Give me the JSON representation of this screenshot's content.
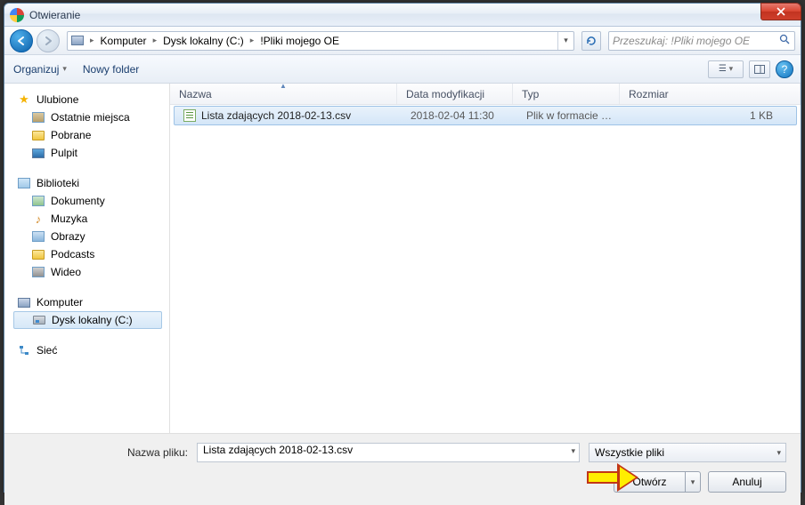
{
  "window": {
    "title": "Otwieranie"
  },
  "breadcrumb": {
    "parts": [
      "Komputer",
      "Dysk lokalny (C:)",
      "!Pliki mojego OE"
    ]
  },
  "search": {
    "placeholder": "Przeszukaj: !Pliki mojego OE"
  },
  "toolbar": {
    "organize": "Organizuj",
    "newfolder": "Nowy folder"
  },
  "sidebar": {
    "favorites": {
      "head": "Ulubione",
      "items": [
        "Ostatnie miejsca",
        "Pobrane",
        "Pulpit"
      ]
    },
    "libraries": {
      "head": "Biblioteki",
      "items": [
        "Dokumenty",
        "Muzyka",
        "Obrazy",
        "Podcasts",
        "Wideo"
      ]
    },
    "computer": {
      "head": "Komputer",
      "items": [
        "Dysk lokalny (C:)"
      ]
    },
    "network": {
      "head": "Sieć"
    }
  },
  "columns": {
    "name": "Nazwa",
    "date": "Data modyfikacji",
    "type": "Typ",
    "size": "Rozmiar"
  },
  "files": [
    {
      "name": "Lista zdających 2018-02-13.csv",
      "date": "2018-02-04 11:30",
      "type": "Plik w formacie w...",
      "size": "1 KB"
    }
  ],
  "footer": {
    "filename_label": "Nazwa pliku:",
    "filename_value": "Lista zdających 2018-02-13.csv",
    "filter": "Wszystkie pliki",
    "open": "Otwórz",
    "cancel": "Anuluj"
  }
}
